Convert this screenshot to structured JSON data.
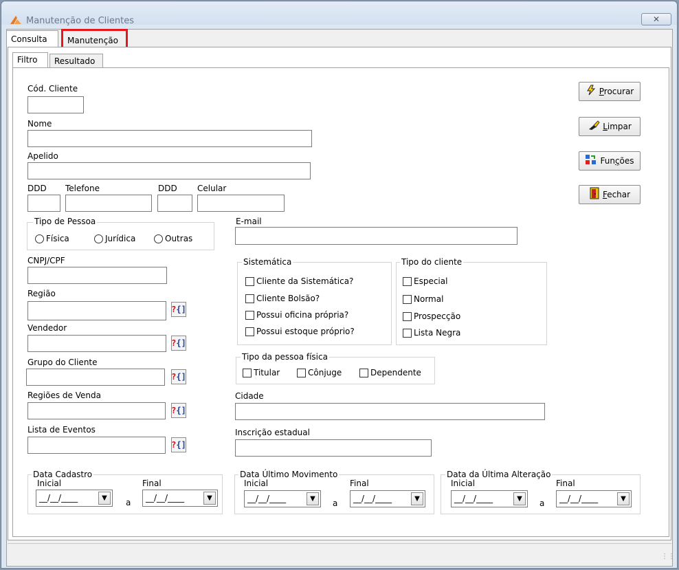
{
  "window": {
    "title": "Manutenção de Clientes",
    "close_label": "✕"
  },
  "tabs": {
    "consulta": "Consulta",
    "manutencao": "Manutenção"
  },
  "subtabs": {
    "filtro": "Filtro",
    "resultado": "Resultado"
  },
  "fields": {
    "cod_cliente": "Cód. Cliente",
    "nome": "Nome",
    "apelido": "Apelido",
    "ddd1": "DDD",
    "telefone": "Telefone",
    "ddd2": "DDD",
    "celular": "Celular",
    "email": "E-mail",
    "cnpj_cpf": "CNPJ/CPF",
    "regiao": "Região",
    "vendedor": "Vendedor",
    "grupo_cliente": "Grupo do Cliente",
    "regioes_venda": "Regiões de Venda",
    "lista_eventos": "Lista de Eventos",
    "cidade": "Cidade",
    "inscricao_estadual": "Inscrição estadual"
  },
  "tipo_pessoa": {
    "title": "Tipo de Pessoa",
    "options": [
      "Física",
      "Jurídica",
      "Outras"
    ]
  },
  "sistematica": {
    "title": "Sistemática",
    "options": [
      "Cliente da Sistemática?",
      "Cliente Bolsão?",
      "Possui oficina própria?",
      "Possui estoque próprio?"
    ]
  },
  "tipo_cliente": {
    "title": "Tipo do cliente",
    "options": [
      "Especial",
      "Normal",
      "Prospecção",
      "Lista Negra"
    ]
  },
  "tipo_pessoa_fisica": {
    "title": "Tipo da pessoa física",
    "options": [
      "Titular",
      "Cônjuge",
      "Dependente"
    ]
  },
  "buttons": {
    "procurar": {
      "pre": "",
      "ul": "P",
      "rest": "rocurar"
    },
    "limpar": {
      "pre": "",
      "ul": "L",
      "rest": "impar"
    },
    "funcoes": {
      "pre": "Fun",
      "ul": "ç",
      "rest": "ões"
    },
    "fechar": {
      "pre": "",
      "ul": "F",
      "rest": "echar"
    }
  },
  "lookup_label": {
    "q": "?",
    "b": "{]"
  },
  "dates": {
    "cadastro": {
      "title": "Data Cadastro"
    },
    "ultimo_movimento": {
      "title": "Data Último Movimento"
    },
    "ultima_alteracao": {
      "title": "Data da Última Alteração"
    },
    "inicial_label": "Inicial",
    "final_label": "Final",
    "a_label": "a",
    "placeholder": "__/__/____",
    "dropdown_glyph": "▼"
  },
  "icons": {
    "app": "app-logo-icon",
    "procurar": "lightning-icon",
    "limpar": "eraser-icon",
    "funcoes": "functions-icon",
    "fechar": "exit-door-icon"
  },
  "colors": {
    "highlight": "#e8161b",
    "window_bg": "#dce7f4"
  }
}
